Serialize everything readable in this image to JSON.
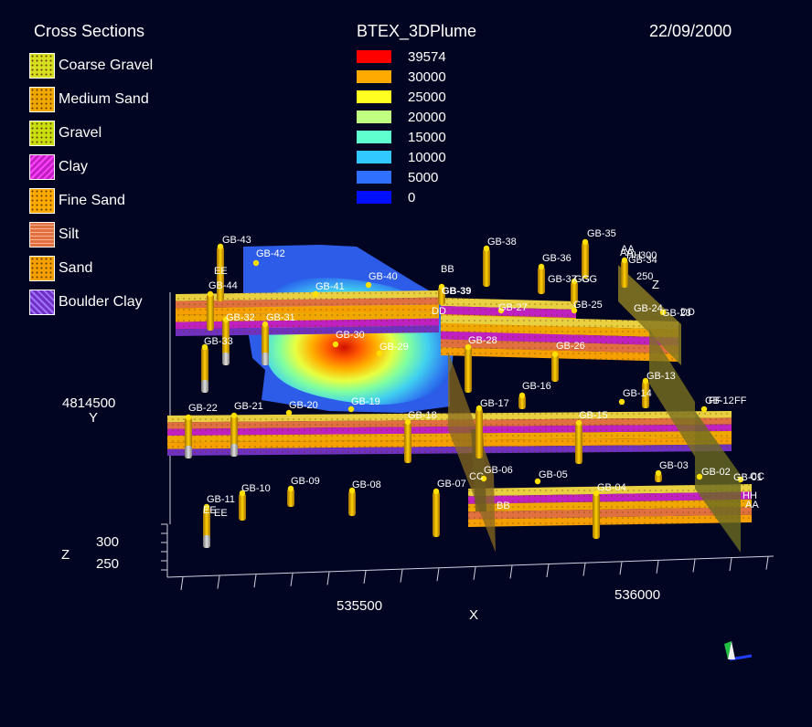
{
  "cross_sections": {
    "title": "Cross Sections",
    "items": [
      {
        "label": "Coarse Gravel",
        "color": "#d6e020",
        "pattern": "dots"
      },
      {
        "label": "Medium Sand",
        "color": "#f0a800",
        "pattern": "dots"
      },
      {
        "label": "Gravel",
        "color": "#c8e010",
        "pattern": "dots"
      },
      {
        "label": "Clay",
        "color": "#c020c0",
        "pattern": "wave"
      },
      {
        "label": "Fine Sand",
        "color": "#ffaa00",
        "pattern": "fine"
      },
      {
        "label": "Silt",
        "color": "#e07040",
        "pattern": "dash"
      },
      {
        "label": "Sand",
        "color": "#f5a000",
        "pattern": "dots"
      },
      {
        "label": "Boulder Clay",
        "color": "#7030c0",
        "pattern": "hatch"
      }
    ]
  },
  "plume": {
    "title": "BTEX_3DPlume",
    "scale": [
      {
        "value": "39574",
        "color": "#ff0000"
      },
      {
        "value": "30000",
        "color": "#ffaa00"
      },
      {
        "value": "25000",
        "color": "#ffff20"
      },
      {
        "value": "20000",
        "color": "#c0ff80"
      },
      {
        "value": "15000",
        "color": "#60ffd0"
      },
      {
        "value": "10000",
        "color": "#30c8ff"
      },
      {
        "value": "5000",
        "color": "#3070ff"
      },
      {
        "value": "0",
        "color": "#0010ff"
      }
    ]
  },
  "date": "22/09/2000",
  "axes": {
    "x_title": "X",
    "x_ticks": [
      "535500",
      "536000"
    ],
    "y_title": "Y",
    "y_tick": "4814500",
    "z_title": "Z",
    "z_ticks": [
      "300",
      "250"
    ]
  },
  "wells": [
    "GB-43",
    "GB-42",
    "GB-44",
    "GB-41",
    "GB-40",
    "GB-39",
    "GB-38",
    "GB-36",
    "GB-35",
    "GB-37",
    "GB-32",
    "GB-31",
    "GB-33",
    "GB-30",
    "GB-29",
    "GB-27",
    "GB-25",
    "GB-24",
    "GB-23",
    "GB-28",
    "GB-26",
    "GB-16",
    "GB-13",
    "GB-14",
    "GB-12",
    "GB-22",
    "GB-21",
    "GB-20",
    "GB-19",
    "GB-18",
    "GB-17",
    "GB-15",
    "GB-10",
    "GB-09",
    "GB-08",
    "GB-07",
    "GB-06",
    "GB-05",
    "GB-04",
    "GB-03",
    "GB-02",
    "GB-01",
    "GB-11",
    "GB-34"
  ],
  "section_labels": [
    "AA",
    "BB",
    "CC",
    "DD",
    "EE",
    "FF",
    "GG",
    "HH",
    "BB",
    "CC",
    "DD",
    "EE",
    "AA",
    "HH",
    "FF",
    "GG",
    "EE",
    "AA"
  ],
  "box_labels": [
    "300",
    "250",
    "Z"
  ]
}
